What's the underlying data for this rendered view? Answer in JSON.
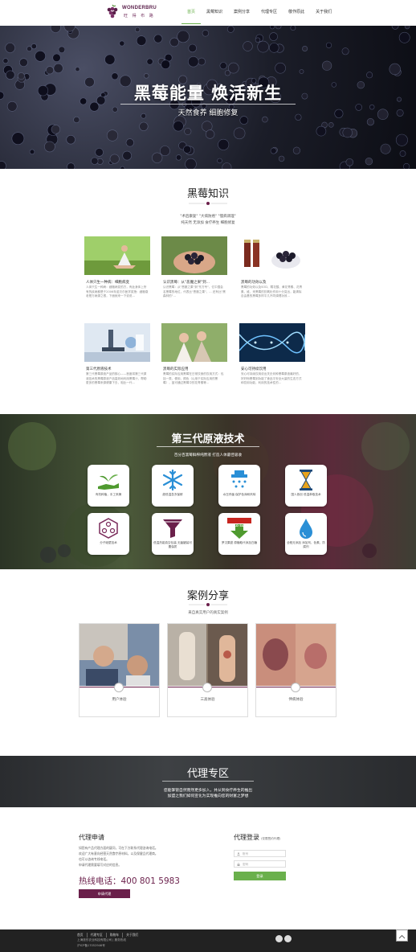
{
  "header": {
    "logo_en": "WONDERBRU",
    "logo_cn": "旺 得 布 路",
    "nav": [
      {
        "label": "首页",
        "active": true
      },
      {
        "label": "黑莓知识",
        "active": false
      },
      {
        "label": "案例分享",
        "active": false
      },
      {
        "label": "代理专区",
        "active": false
      },
      {
        "label": "敬作原此",
        "active": false
      },
      {
        "label": "关于我们",
        "active": false
      }
    ]
  },
  "hero": {
    "title": "黑莓能量 焕活新生",
    "subtitle": "天然食养 细胞修复"
  },
  "knowledge": {
    "title": "黑莓知识",
    "intro_line1": "\"术后康复\" \"大病防癌\" \"慢病调理\"",
    "intro_line2": "纯天然 无添加 食疗养生 细胞修复",
    "cards": [
      {
        "title": "人体只生一种病：细胞病变",
        "desc": "人体只生一种病：细胞病变的方，有此身体上所有的疾病都是于2006年诺贝尔医学奖授：细胞衰老是万病源之根，下面就来一下说说..."
      },
      {
        "title": "认识黑莓：从\"恶魔之果\"到...",
        "desc": "认识黑莓：从\"恶魔之果\"到\"东方专\"，亿中国会名黑莓的地位，代表比\"恶魔之果\"，... 还有比\"黑森林的\"..."
      },
      {
        "title": "黑莓的功效以及",
        "desc": "黑莓的功效以及SOD、鞣花酸、黄花青素、花青素、维、来黑莓的抗氧化作用十分突出，能清除自由基的黑莓多样平几不同调理功效..."
      },
      {
        "title": "第三代原液技术",
        "desc": "第三代黑莓原液产品的核心——首度将第三代原液技术的黑莓原液产品高效地利用黑莓汁，帮助更多的黑莓来源健康下去，相比一代..."
      },
      {
        "title": "黑莓的实际应用",
        "desc": "黑莓的实际应用黑莓在日常饮食的饮用方式：包括一类，便用，颜色（以用于实际应用的黑莓），蓝可通过黑莓中的花青素等..."
      },
      {
        "title": "安心可持续饮用",
        "desc": "安心可持续饮用说出关无何种黑莓原液最好的，好好而黑莓到功能了食品平安全大量的生态方式和饮用功能，利用的技术性的..."
      }
    ]
  },
  "tech": {
    "title": "第三代原液技术",
    "subtitle": "百分百黑莓鲜榨纯原液 打造人体最佳吸收",
    "tiles": [
      {
        "label": "有机种植，手工采摘"
      },
      {
        "label": "超低温急冻保鲜"
      },
      {
        "label": "水压杀菌 保护色泽和风味"
      },
      {
        "label": "国人首创 低温萃取技术"
      },
      {
        "label": "分子破壁技术"
      },
      {
        "label": "低温热能真空包装 无菌罐装可置保质"
      },
      {
        "label": "罗汉果甜 原糖取代添加白糖"
      },
      {
        "label": "全程无添加 添加剂、色素、防腐剂"
      }
    ],
    "bold_badge": "BOLLD SUGAR"
  },
  "cases": {
    "title": "案例分享",
    "subtitle": "来自真实用户的真实案例",
    "items": [
      {
        "label": "用户体验"
      },
      {
        "label": "三高体验"
      },
      {
        "label": "伸病体验"
      }
    ]
  },
  "agent": {
    "title": "代理专区",
    "line1": "您能掌管自然而然更多加入，并从到食疗养生的推出",
    "line2": "加盟之我们如何宣化为实现推向您的财富之梦想"
  },
  "apply": {
    "title": "代理申请",
    "lines": [
      "如您有产品代理方面的疑问，可在下方联系代理咨询电话。",
      "欢迎广大有意向经营天然食疗原材料，以及保健品代理商。",
      "也可以咨询专线电话。",
      "申请代理需要填写对应的信息。"
    ],
    "hotline": "热线电话：400 801 5983",
    "button": "申请代理"
  },
  "login": {
    "title": "代理登录",
    "hint": "(仅限签约代理)",
    "username_placeholder": "账号",
    "password_placeholder": "密码",
    "button": "登录"
  },
  "footer": {
    "nav": [
      "首页",
      "代理专区",
      "购物车",
      "关于我们"
    ],
    "company": "上海钱东农业科技有限公司  |  服务热线",
    "icp": "沪ICP备17052946号"
  },
  "colors": {
    "brand_purple": "#6a1f4a",
    "accent_green": "#6ab04c",
    "footer_bg": "#222222"
  }
}
